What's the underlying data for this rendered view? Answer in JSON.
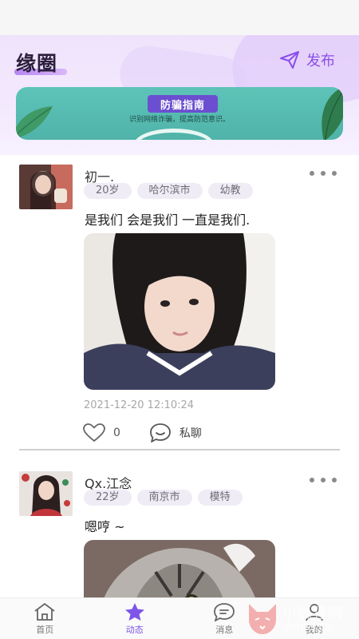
{
  "header": {
    "title": "缘圈",
    "publish_label": "发布"
  },
  "banner": {
    "title": "防骗指南",
    "subtitle": "识别网络诈骗，提高防范意识。"
  },
  "posts": [
    {
      "username": "初一.",
      "tags": [
        "20岁",
        "哈尔滨市",
        "幼教"
      ],
      "content": "是我们 会是我们 一直是我们.",
      "timestamp": "2021-12-20 12:10:24",
      "like_count": "0",
      "chat_label": "私聊"
    },
    {
      "username": "Qx.江念",
      "tags": [
        "22岁",
        "南京市",
        "模特"
      ],
      "content": "嗯哼 ~"
    }
  ],
  "nav": {
    "items": [
      {
        "label": "首页",
        "icon": "home-icon"
      },
      {
        "label": "动态",
        "icon": "star-icon"
      },
      {
        "label": "消息",
        "icon": "message-icon"
      },
      {
        "label": "我的",
        "icon": "profile-icon"
      }
    ],
    "active": "动态"
  },
  "watermark": {
    "text": "小狐狸网",
    "url": "XHHSS.CN"
  },
  "colors": {
    "accent": "#8b4ee8",
    "banner": "#5ec3b8",
    "header_bg": "#efe3fb"
  }
}
